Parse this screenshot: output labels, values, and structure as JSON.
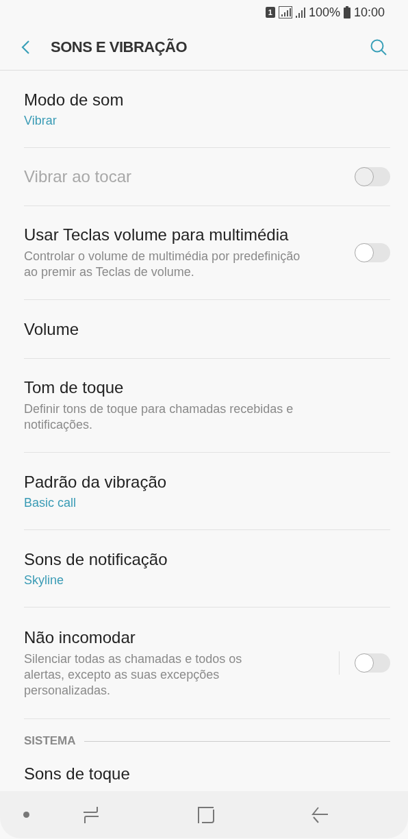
{
  "status_bar": {
    "sim": "1",
    "battery": "100%",
    "time": "10:00"
  },
  "header": {
    "title": "SONS E VIBRAÇÃO"
  },
  "settings": [
    {
      "kind": "value",
      "title": "Modo de som",
      "value": "Vibrar"
    },
    {
      "kind": "toggle",
      "title": "Vibrar ao tocar",
      "disabled": true,
      "on": false,
      "separated": false
    },
    {
      "kind": "toggle",
      "title": "Usar Teclas volume para multimédia",
      "description": "Controlar o volume de multimédia por predefinição ao premir as Teclas de volume.",
      "disabled": false,
      "on": false,
      "separated": false
    },
    {
      "kind": "plain",
      "title": "Volume"
    },
    {
      "kind": "plain",
      "title": "Tom de toque",
      "description": "Definir tons de toque para chamadas recebidas e notificações."
    },
    {
      "kind": "value",
      "title": "Padrão da vibração",
      "value": "Basic call"
    },
    {
      "kind": "value",
      "title": "Sons de notificação",
      "value": "Skyline"
    },
    {
      "kind": "toggle",
      "title": "Não incomodar",
      "description": "Silenciar todas as chamadas e todos os alertas, excepto as suas excepções personalizadas.",
      "disabled": false,
      "on": false,
      "separated": true
    },
    {
      "kind": "section",
      "title": "SISTEMA"
    },
    {
      "kind": "plain",
      "title": "Sons de toque"
    }
  ]
}
